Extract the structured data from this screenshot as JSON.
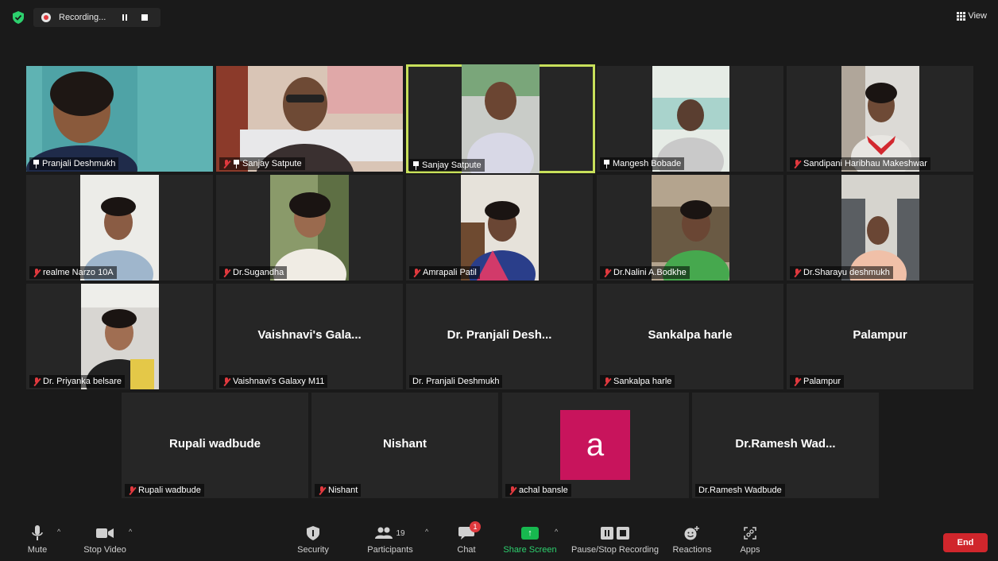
{
  "topbar": {
    "recording_label": "Recording...",
    "view_label": "View"
  },
  "tiles": [
    {
      "name": "Pranjali Deshmukh",
      "muted": false,
      "pinned": true,
      "video": true
    },
    {
      "name": "Sanjay Satpute",
      "muted": true,
      "pinned": true,
      "video": true
    },
    {
      "name": "Sanjay Satpute",
      "muted": false,
      "pinned": true,
      "video": true,
      "active": true
    },
    {
      "name": "Mangesh Bobade",
      "muted": false,
      "pinned": true,
      "video": true
    },
    {
      "name": "Sandipani Haribhau Makeshwar",
      "muted": true,
      "pinned": false,
      "video": true
    },
    {
      "name": "realme Narzo 10A",
      "muted": true,
      "pinned": false,
      "video": true
    },
    {
      "name": "Dr.Sugandha",
      "muted": true,
      "pinned": false,
      "video": true
    },
    {
      "name": "Amrapali Patil",
      "muted": true,
      "pinned": false,
      "video": true
    },
    {
      "name": "Dr.Nalini A.Bodkhe",
      "muted": true,
      "pinned": false,
      "video": true
    },
    {
      "name": "Dr.Sharayu deshmukh",
      "muted": true,
      "pinned": false,
      "video": true
    },
    {
      "name": "Dr. Priyanka belsare",
      "muted": true,
      "pinned": false,
      "video": true
    },
    {
      "name": "Vaishnavi's Galaxy M11",
      "display": "Vaishnavi's Gala...",
      "muted": true,
      "pinned": false,
      "video": false
    },
    {
      "name": "Dr. Pranjali Deshmukh",
      "display": "Dr. Pranjali Desh...",
      "muted": false,
      "pinned": false,
      "video": false
    },
    {
      "name": "Sankalpa harle",
      "display": "Sankalpa harle",
      "muted": true,
      "pinned": false,
      "video": false
    },
    {
      "name": "Palampur",
      "display": "Palampur",
      "muted": true,
      "pinned": false,
      "video": false
    },
    {
      "name": "Rupali wadbude",
      "display": "Rupali wadbude",
      "muted": true,
      "pinned": false,
      "video": false
    },
    {
      "name": "Nishant",
      "display": "Nishant",
      "muted": true,
      "pinned": false,
      "video": false
    },
    {
      "name": "achal bansle",
      "avatar_letter": "a",
      "muted": true,
      "pinned": false,
      "video": false
    },
    {
      "name": "Dr.Ramesh Wadbude",
      "display": "Dr.Ramesh Wad...",
      "muted": false,
      "pinned": false,
      "video": false
    }
  ],
  "toolbar": {
    "mute": "Mute",
    "stop_video": "Stop Video",
    "security": "Security",
    "participants": "Participants",
    "participants_count": "19",
    "chat": "Chat",
    "chat_badge": "1",
    "share_screen": "Share Screen",
    "pause_stop_recording": "Pause/Stop Recording",
    "reactions": "Reactions",
    "apps": "Apps",
    "end": "End"
  },
  "colors": {
    "background": "#1a1a1a",
    "tile": "#262626",
    "active_border": "#c8e05a",
    "muted_red": "#e0393e",
    "share_green": "#17b84f",
    "end_red": "#d0262c",
    "avatar_pink": "#c8145c"
  }
}
